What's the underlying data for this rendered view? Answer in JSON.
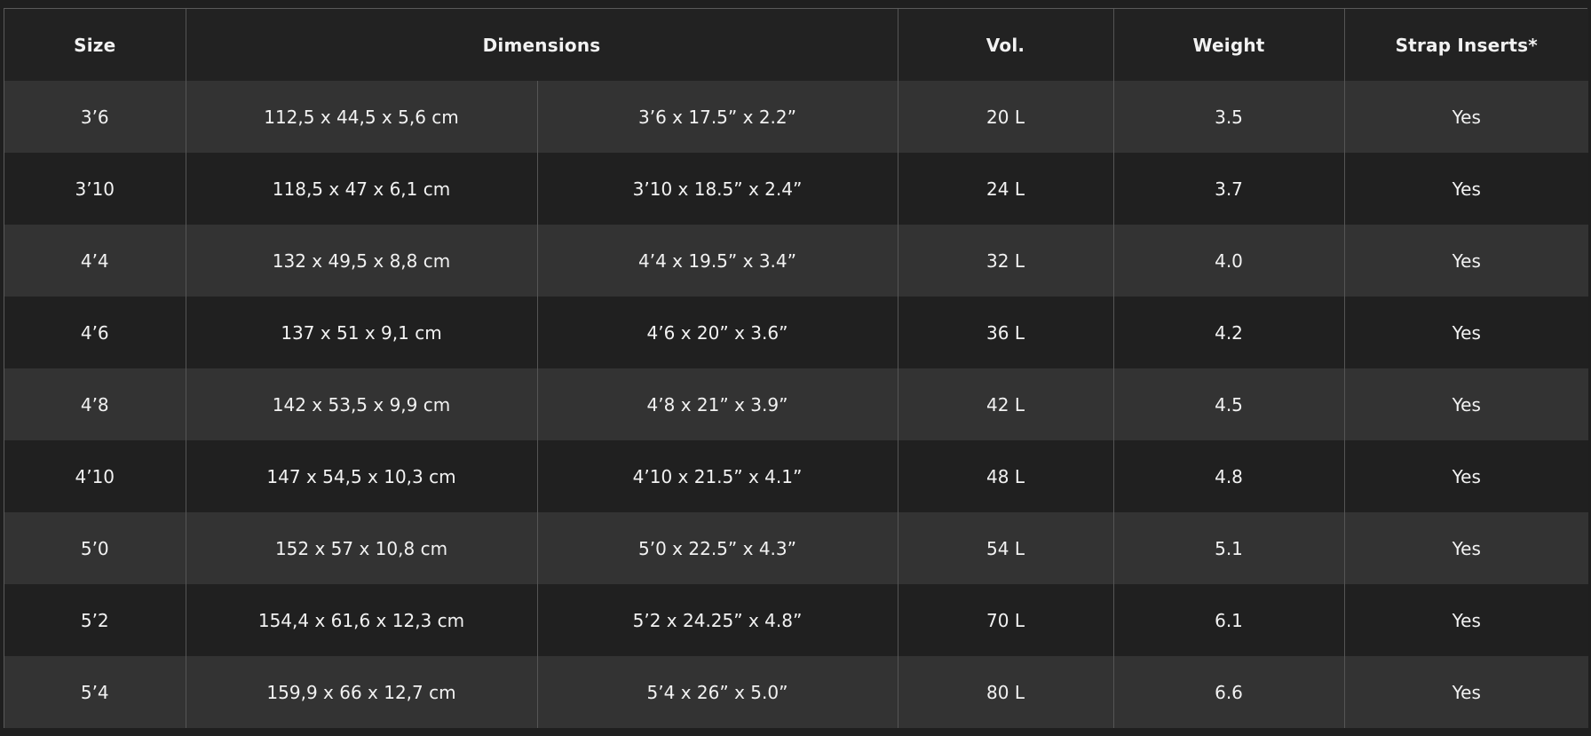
{
  "table": {
    "headers": {
      "size": "Size",
      "dimensions": "Dimensions",
      "vol": "Vol.",
      "weight": "Weight",
      "strap_inserts": "Strap Inserts*"
    },
    "rows": [
      {
        "size": "3’6",
        "dim_cm": "112,5 x 44,5 x 5,6 cm",
        "dim_in": "3’6 x 17.5” x 2.2”",
        "vol": "20 L",
        "weight": "3.5",
        "strap": "Yes"
      },
      {
        "size": "3’10",
        "dim_cm": "118,5 x 47 x 6,1 cm",
        "dim_in": "3’10 x 18.5” x 2.4”",
        "vol": "24 L",
        "weight": "3.7",
        "strap": "Yes"
      },
      {
        "size": "4’4",
        "dim_cm": "132 x 49,5 x 8,8 cm",
        "dim_in": "4’4 x 19.5” x 3.4”",
        "vol": "32 L",
        "weight": "4.0",
        "strap": "Yes"
      },
      {
        "size": "4’6",
        "dim_cm": "137 x 51 x 9,1 cm",
        "dim_in": "4’6 x 20” x 3.6”",
        "vol": "36 L",
        "weight": "4.2",
        "strap": "Yes"
      },
      {
        "size": "4’8",
        "dim_cm": "142 x 53,5 x 9,9 cm",
        "dim_in": "4’8 x 21” x 3.9”",
        "vol": "42 L",
        "weight": "4.5",
        "strap": "Yes"
      },
      {
        "size": "4’10",
        "dim_cm": "147 x 54,5 x 10,3 cm",
        "dim_in": "4’10 x 21.5” x 4.1”",
        "vol": "48 L",
        "weight": "4.8",
        "strap": "Yes"
      },
      {
        "size": "5’0",
        "dim_cm": "152 x 57 x 10,8 cm",
        "dim_in": "5’0 x 22.5” x 4.3”",
        "vol": "54 L",
        "weight": "5.1",
        "strap": "Yes"
      },
      {
        "size": "5’2",
        "dim_cm": "154,4 x 61,6 x 12,3 cm",
        "dim_in": "5’2 x 24.25” x 4.8”",
        "vol": "70 L",
        "weight": "6.1",
        "strap": "Yes"
      },
      {
        "size": "5’4",
        "dim_cm": "159,9 x 66 x 12,7 cm",
        "dim_in": "5’4 x 26” x 5.0”",
        "vol": "80 L",
        "weight": "6.6",
        "strap": "Yes"
      }
    ]
  }
}
